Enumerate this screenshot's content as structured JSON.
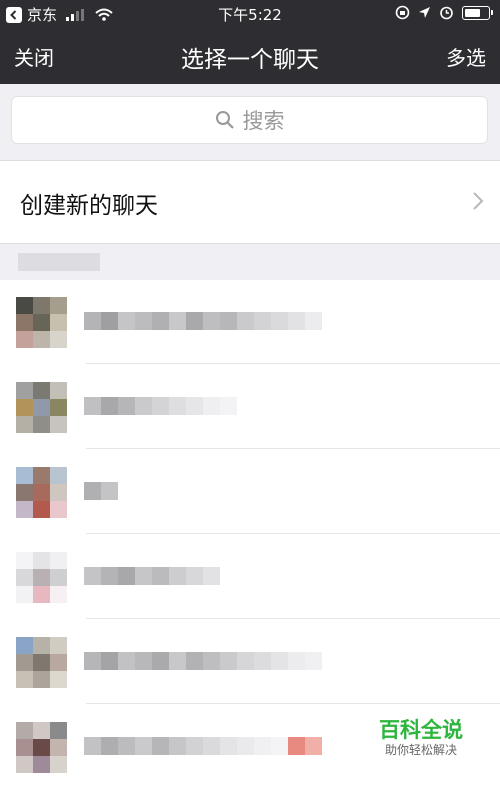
{
  "status_bar": {
    "carrier": "京东",
    "time": "下午5:22"
  },
  "nav": {
    "close_label": "关闭",
    "title": "选择一个聊天",
    "multi_select_label": "多选"
  },
  "search": {
    "placeholder": "搜索",
    "icon": "search-icon"
  },
  "create_chat": {
    "label": "创建新的聊天",
    "icon": "chevron-right-icon"
  },
  "watermark": {
    "brand": "百科全说",
    "slogan": "助你轻松解决"
  },
  "colors": {
    "nav_background": "#2e2e32",
    "page_background": "#efeff4",
    "watermark_green": "#2db53d"
  }
}
